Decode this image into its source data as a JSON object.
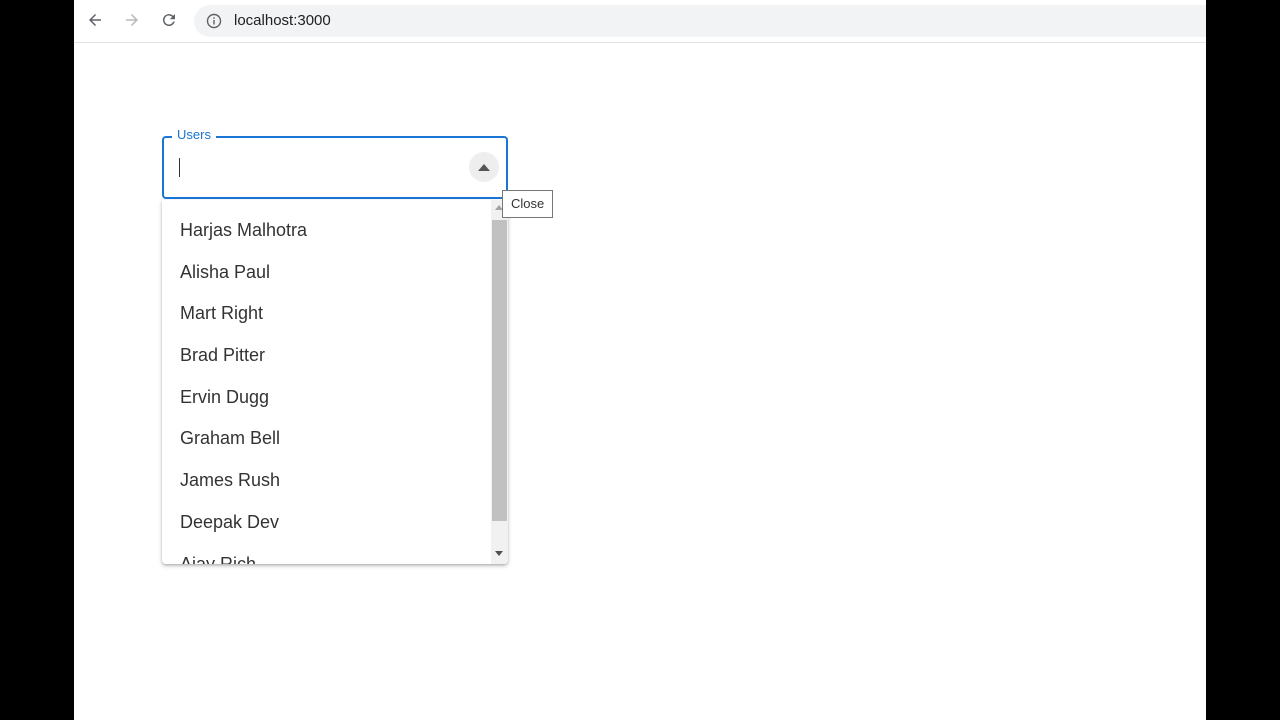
{
  "browser": {
    "url": "localhost:3000"
  },
  "autocomplete": {
    "label": "Users",
    "value": "",
    "tooltip": "Close",
    "options": [
      "Harjas Malhotra",
      "Alisha Paul",
      "Mart Right",
      "Brad Pitter",
      "Ervin Dugg",
      "Graham Bell",
      "James Rush",
      "Deepak Dev",
      "Ajay Rich"
    ]
  },
  "colors": {
    "accent": "#1976d2",
    "page_background": "#ffffff",
    "outer_background": "#000000"
  }
}
